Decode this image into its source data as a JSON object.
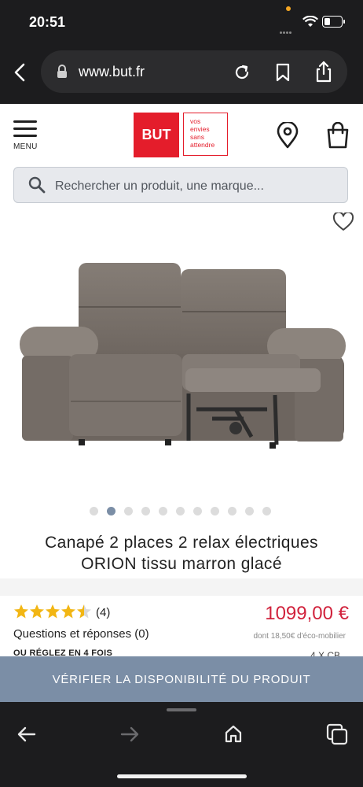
{
  "status_bar": {
    "time": "20:51"
  },
  "browser": {
    "url": "www.but.fr"
  },
  "header": {
    "menu_label": "MENU",
    "logo_text": "BUT",
    "logo_tagline": [
      "vos",
      "envies",
      "sans",
      "attendre"
    ]
  },
  "search": {
    "placeholder": "Rechercher un produit, une marque..."
  },
  "product": {
    "title_line1": "Canapé 2 places 2 relax électriques",
    "title_line2": "ORION tissu marron glacé",
    "image_count": 11,
    "active_image_index": 1,
    "rating": 4.5,
    "rating_max": 5,
    "review_count": "(4)",
    "questions_link": "Questions et réponses (0)",
    "price": "1099,00 €",
    "eco_participation": "dont 18,50€ d'éco-mobilier",
    "payment_text": "OU RÉGLEZ EN 4 FOIS",
    "payment_right": "4 X CB"
  },
  "cta": {
    "label": "VÉRIFIER LA DISPONIBILITÉ DU PRODUIT"
  },
  "colors": {
    "brand_red": "#e41d2b",
    "price_red": "#d1223c",
    "cta_blue": "#7b8ea6",
    "star_gold": "#f2b614"
  }
}
